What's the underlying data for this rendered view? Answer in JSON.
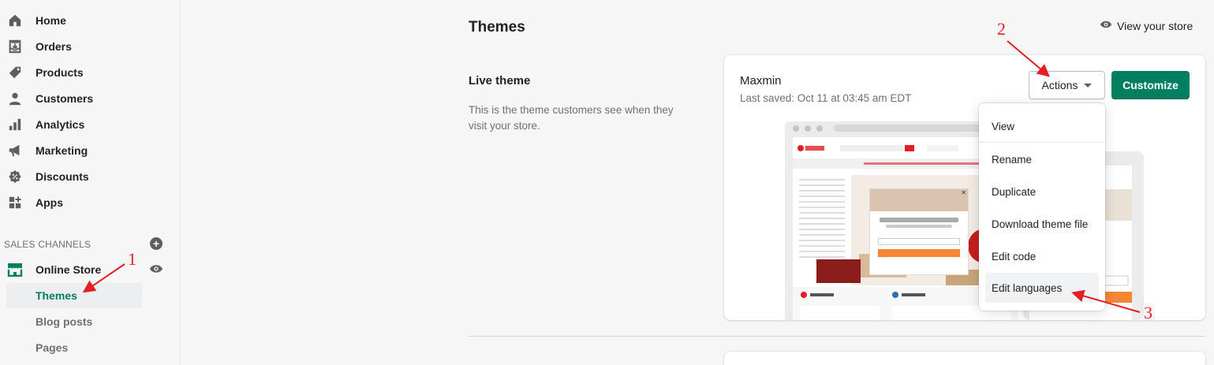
{
  "sidebar": {
    "items": [
      {
        "label": "Home",
        "icon": "home-icon"
      },
      {
        "label": "Orders",
        "icon": "orders-icon"
      },
      {
        "label": "Products",
        "icon": "tag-icon"
      },
      {
        "label": "Customers",
        "icon": "person-icon"
      },
      {
        "label": "Analytics",
        "icon": "bar-chart-icon"
      },
      {
        "label": "Marketing",
        "icon": "megaphone-icon"
      },
      {
        "label": "Discounts",
        "icon": "discount-icon"
      },
      {
        "label": "Apps",
        "icon": "apps-icon"
      }
    ],
    "sales_channels_heading": "SALES CHANNELS",
    "online_store": {
      "label": "Online Store",
      "sub_items": [
        {
          "label": "Themes",
          "active": true
        },
        {
          "label": "Blog posts",
          "active": false
        },
        {
          "label": "Pages",
          "active": false
        }
      ]
    }
  },
  "header": {
    "title": "Themes",
    "view_store_label": "View your store"
  },
  "live_theme": {
    "heading": "Live theme",
    "description": "This is the theme customers see when they visit your store."
  },
  "theme_card": {
    "name": "Maxmin",
    "last_saved": "Last saved: Oct 11 at 03:45 am EDT",
    "actions_label": "Actions",
    "customize_label": "Customize"
  },
  "actions_menu": {
    "items": [
      {
        "label": "View"
      },
      {
        "label": "Rename"
      },
      {
        "label": "Duplicate"
      },
      {
        "label": "Download theme file"
      },
      {
        "label": "Edit code"
      },
      {
        "label": "Edit languages",
        "highlighted": true
      }
    ]
  },
  "annotations": {
    "step1": "1",
    "step2": "2",
    "step3": "3"
  },
  "colors": {
    "brand_green": "#008060",
    "active_text": "#007f5f",
    "annotation_red": "#e31e24"
  }
}
